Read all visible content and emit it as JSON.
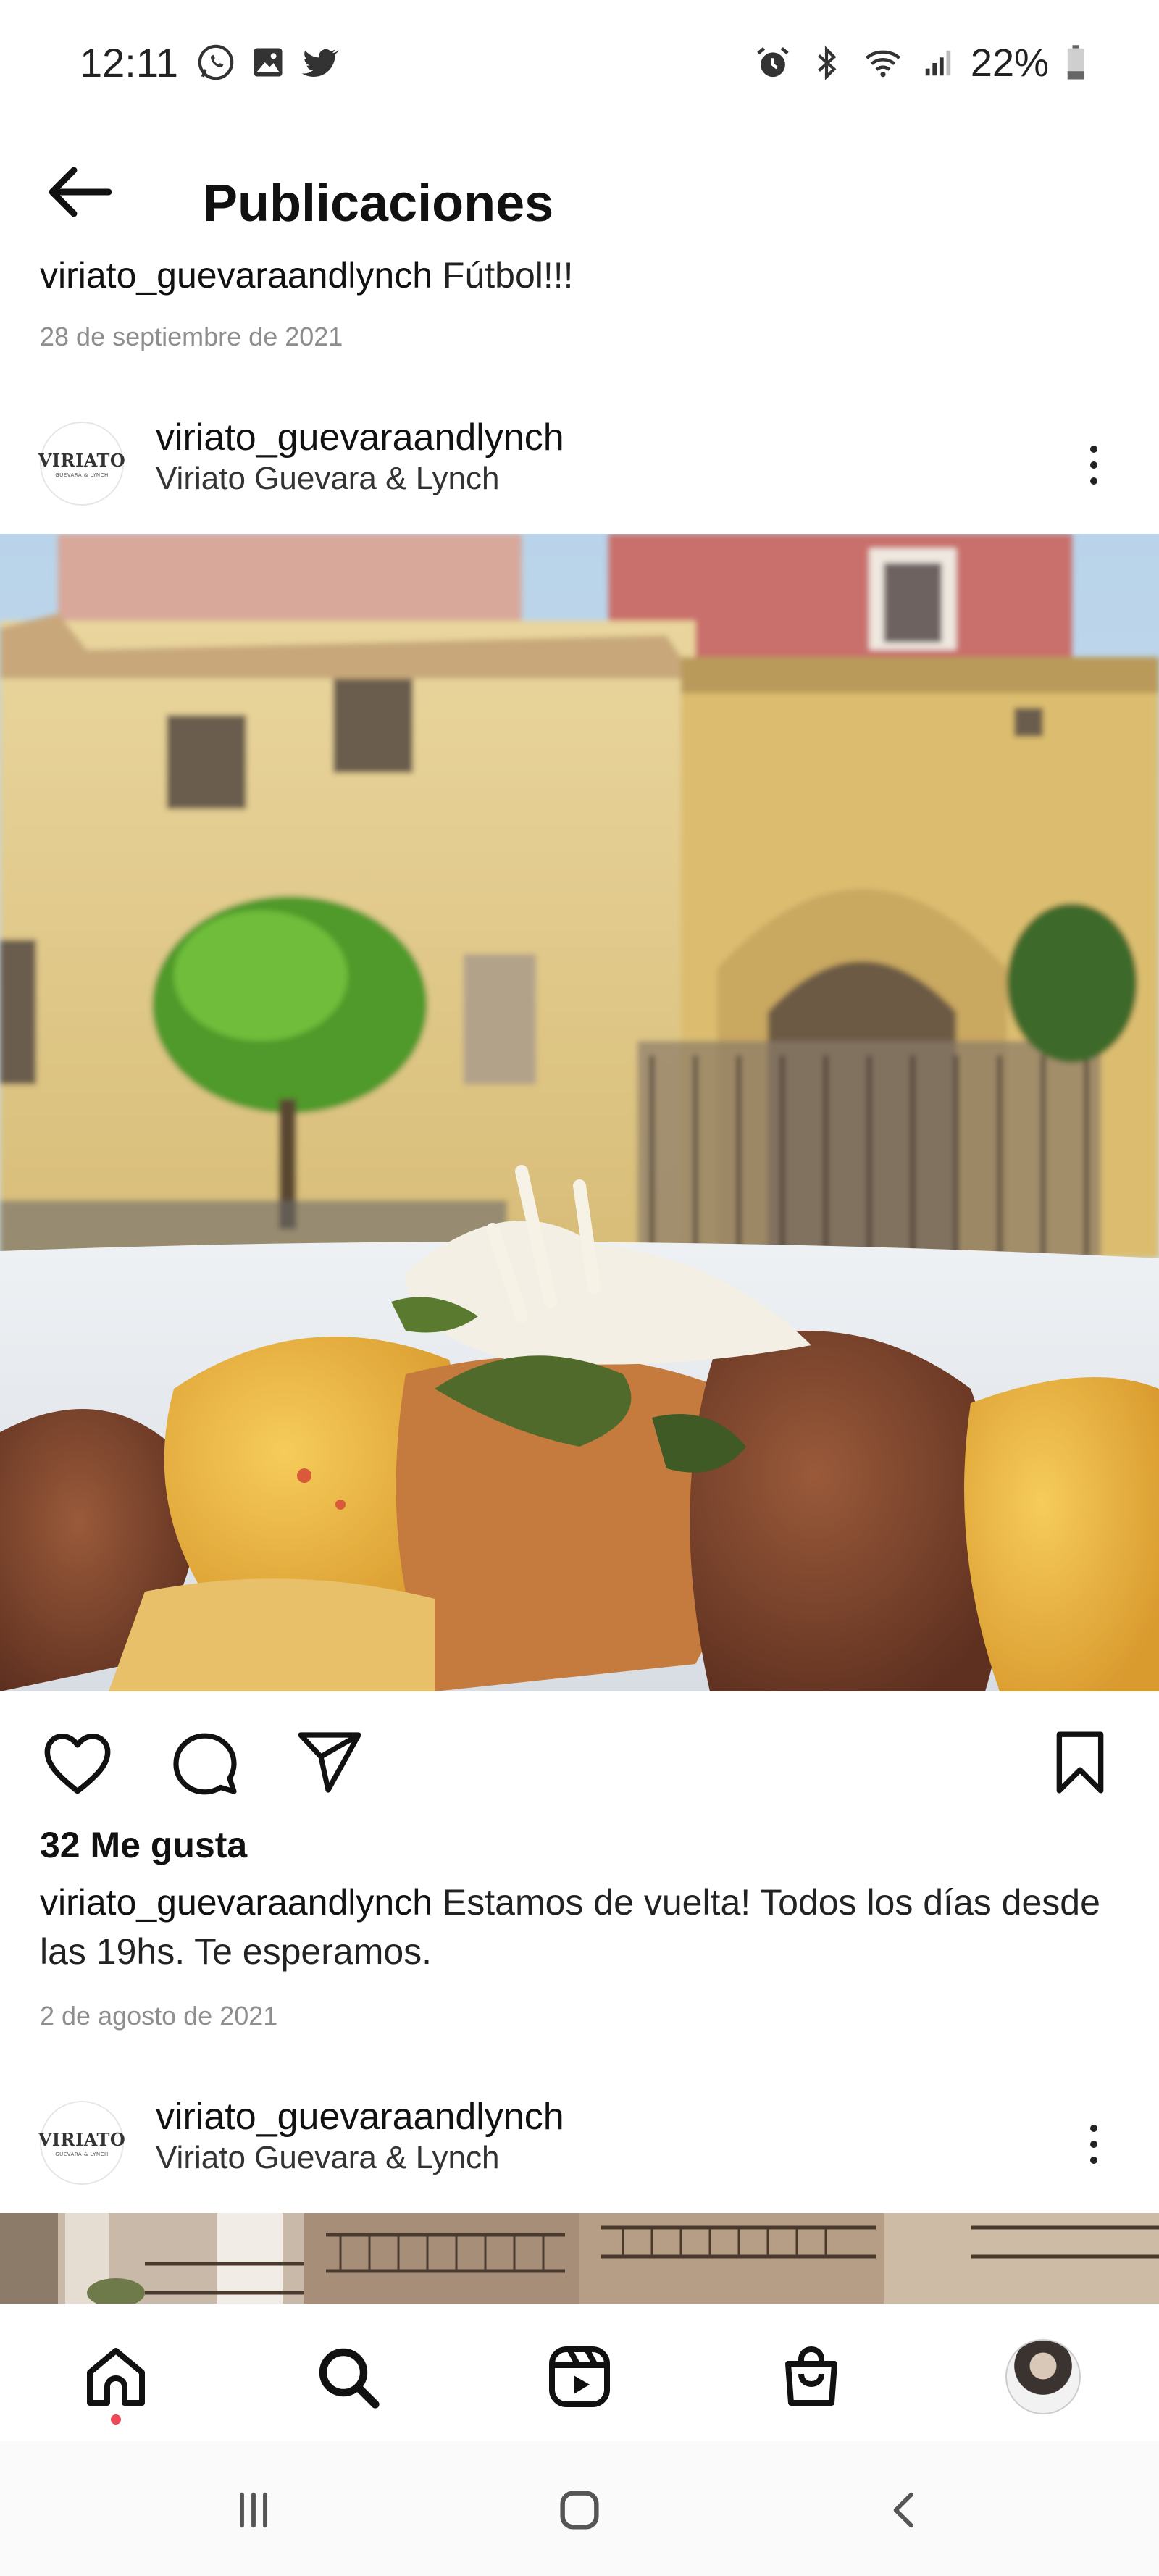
{
  "status_bar": {
    "time": "12:11",
    "battery": "22%",
    "left_icons": [
      "whatsapp-icon",
      "gallery-icon",
      "twitter-icon"
    ],
    "right_icons": [
      "alarm-icon",
      "bluetooth-icon",
      "wifi-icon",
      "signal-icon",
      "battery-icon"
    ]
  },
  "header": {
    "title": "Publicaciones"
  },
  "previous_post": {
    "username": "viriato_guevaraandlynch",
    "caption": " Fútbol!!!",
    "date": "28 de septiembre de 2021"
  },
  "post": {
    "username": "viriato_guevaraandlynch",
    "subtitle": "Viriato Guevara & Lynch",
    "avatar_logo_main": "VIRIATO",
    "avatar_logo_sub": "GUEVARA & LYNCH",
    "likes": "32 Me gusta",
    "caption_user": "viriato_guevaraandlynch",
    "caption_text": " Estamos de vuelta! Todos los días desde las 19hs. Te esperamos.",
    "date": "2 de agosto de 2021"
  },
  "next_post": {
    "username": "viriato_guevaraandlynch",
    "subtitle": "Viriato Guevara & Lynch",
    "avatar_logo_main": "VIRIATO",
    "avatar_logo_sub": "GUEVARA & LYNCH"
  },
  "bottom_nav": {
    "items": [
      "home-icon",
      "search-icon",
      "reels-icon",
      "shop-icon",
      "profile-avatar"
    ],
    "active": "home",
    "notification_color": "#ed4956"
  },
  "colors": {
    "text_primary": "#111111",
    "text_secondary": "#8e8e8e",
    "background": "#ffffff"
  }
}
